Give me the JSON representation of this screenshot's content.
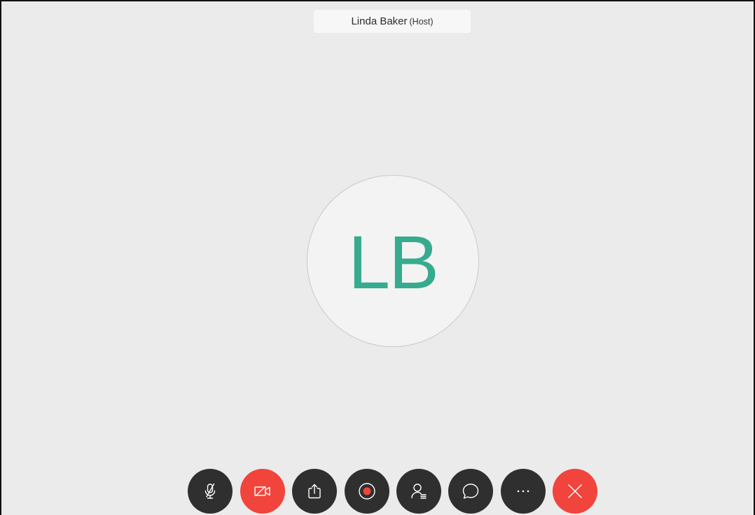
{
  "participant": {
    "name": "Linda Baker",
    "role": "(Host)",
    "initials": "LB",
    "initials_color": "#36ab8e"
  },
  "toolbar": {
    "buttons": [
      {
        "name": "mute-button",
        "icon": "microphone-muted-icon",
        "style": "dark"
      },
      {
        "name": "video-button",
        "icon": "video-off-icon",
        "style": "red"
      },
      {
        "name": "share-button",
        "icon": "share-upload-icon",
        "style": "dark"
      },
      {
        "name": "record-button",
        "icon": "record-icon",
        "style": "dark"
      },
      {
        "name": "participants-button",
        "icon": "participants-icon",
        "style": "dark"
      },
      {
        "name": "chat-button",
        "icon": "chat-bubble-icon",
        "style": "dark"
      },
      {
        "name": "more-button",
        "icon": "more-options-icon",
        "style": "dark"
      },
      {
        "name": "leave-button",
        "icon": "close-icon",
        "style": "red"
      }
    ]
  },
  "colors": {
    "background": "#ebebeb",
    "button_dark": "#2f2f2f",
    "button_red": "#f1443c",
    "record_dot": "#f1443c"
  }
}
